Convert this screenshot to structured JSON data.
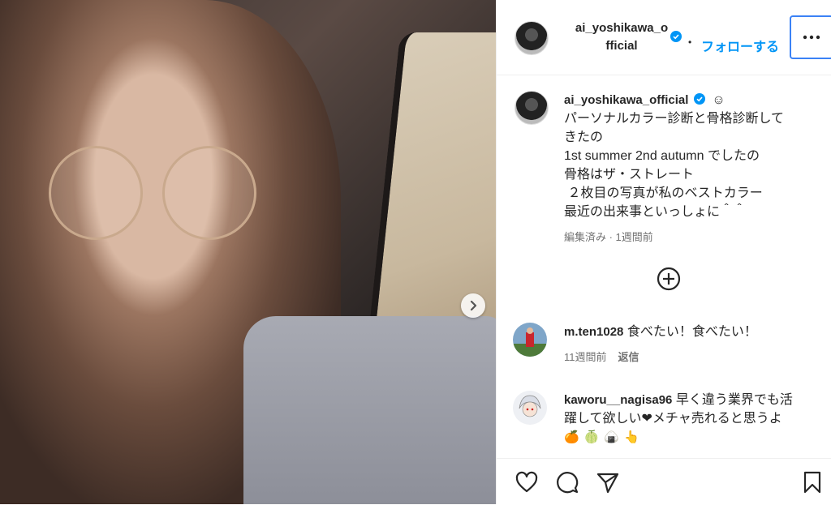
{
  "post": {
    "username": "ai_yoshikawa_official",
    "username_wrapped_1": "ai_yoshikawa_o",
    "username_wrapped_2": "fficial",
    "follow_label": "フォローする",
    "separator": "•"
  },
  "caption": {
    "username": "ai_yoshikawa_official",
    "emoji": "☺",
    "lines": [
      "パーソナルカラー診断と骨格診断して",
      "きたの",
      "1st summer 2nd autumn でしたの",
      "骨格はザ・ストレート",
      " ２枚目の写真が私のベストカラー",
      "最近の出来事といっしょに＾＾"
    ],
    "meta": "編集済み · 1週間前"
  },
  "comments": [
    {
      "username": "m.ten1028",
      "text": "食べたい！食べたい！",
      "time": "11週間前",
      "reply_label": "返信"
    },
    {
      "username": "kaworu__nagisa96",
      "text_line1": "早く違う業界でも活",
      "text_line2": "躍して欲しい❤︎メチャ売れると思うよ",
      "emojis": "🍊🍈🍙👆"
    }
  ],
  "colors": {
    "accent": "#0095f6",
    "verified": "#0095f6",
    "focus": "#3b82f6"
  },
  "icons": [
    "verified-badge-icon",
    "more-options-icon",
    "add-comment-icon",
    "next-arrow-icon",
    "like-icon",
    "comment-icon",
    "share-icon",
    "save-icon"
  ]
}
